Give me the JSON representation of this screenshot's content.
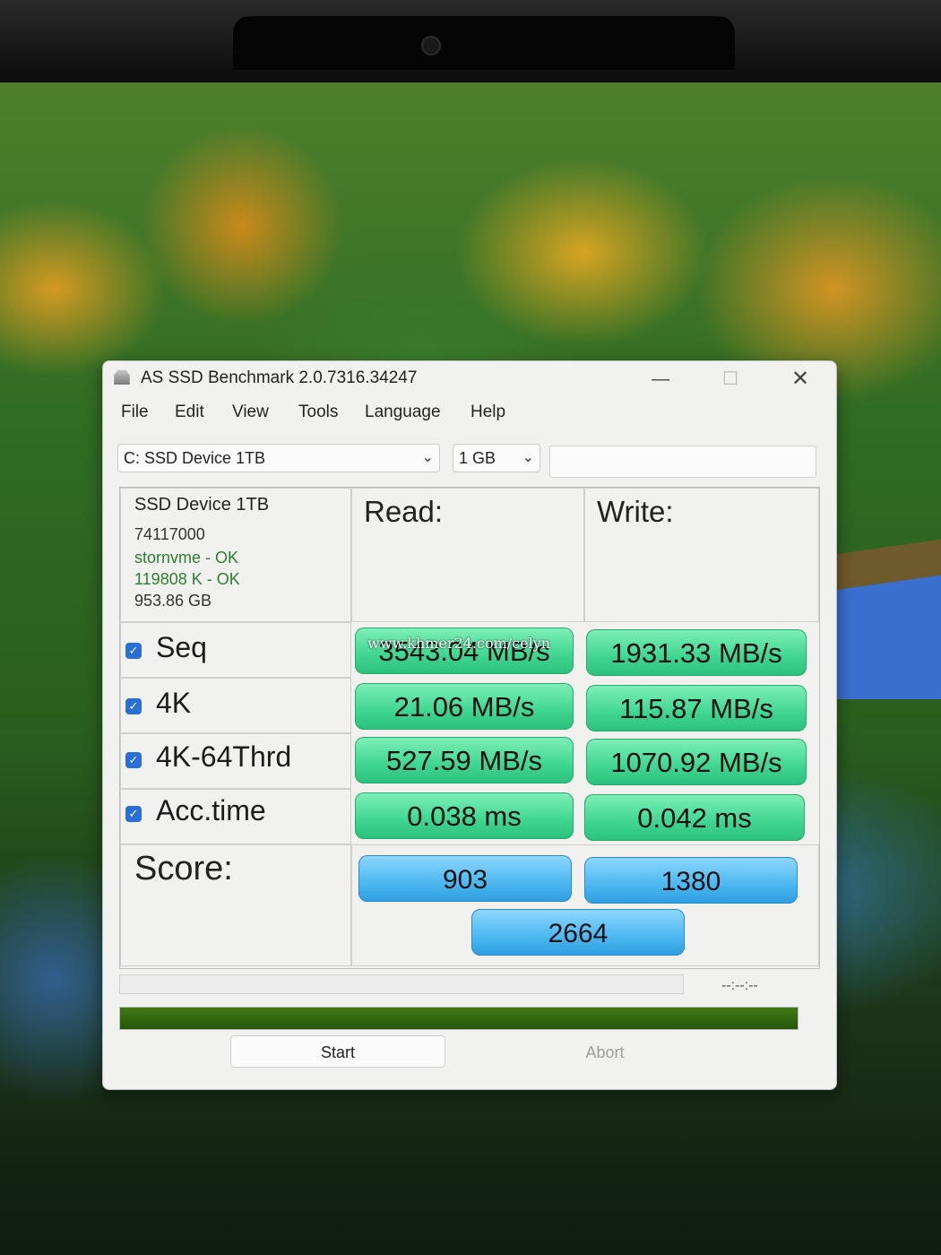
{
  "window": {
    "title": "AS SSD Benchmark 2.0.7316.34247",
    "controls": {
      "minimize": "—",
      "maximize": "☐",
      "close": "✕"
    }
  },
  "menu": [
    "File",
    "Edit",
    "View",
    "Tools",
    "Language",
    "Help"
  ],
  "toolbar": {
    "drive_select": "C: SSD Device 1TB",
    "size_select": "1 GB",
    "status_text": ""
  },
  "device": {
    "name": "SSD Device 1TB",
    "id": "74117000",
    "driver": "stornvme - OK",
    "alignment": "119808 K - OK",
    "capacity": "953.86 GB"
  },
  "columns": {
    "read": "Read:",
    "write": "Write:"
  },
  "tests": [
    {
      "name": "Seq",
      "checked": true,
      "read": "3543.04 MB/s",
      "write": "1931.33 MB/s"
    },
    {
      "name": "4K",
      "checked": true,
      "read": "21.06 MB/s",
      "write": "115.87 MB/s"
    },
    {
      "name": "4K-64Thrd",
      "checked": true,
      "read": "527.59 MB/s",
      "write": "1070.92 MB/s"
    },
    {
      "name": "Acc.time",
      "checked": true,
      "read": "0.038 ms",
      "write": "0.042 ms"
    }
  ],
  "score": {
    "label": "Score:",
    "read": "903",
    "write": "1380",
    "total": "2664"
  },
  "watermark": "www.khmer24.com/celyn",
  "progress": {
    "time_readout": "--:--:--",
    "fraction": 1.0
  },
  "buttons": {
    "start": "Start",
    "abort": "Abort"
  },
  "colors": {
    "result_green": "#3fd690",
    "score_blue": "#4cb7f0",
    "progress_green": "#2f650f",
    "checkbox_blue": "#2a6fd4"
  }
}
